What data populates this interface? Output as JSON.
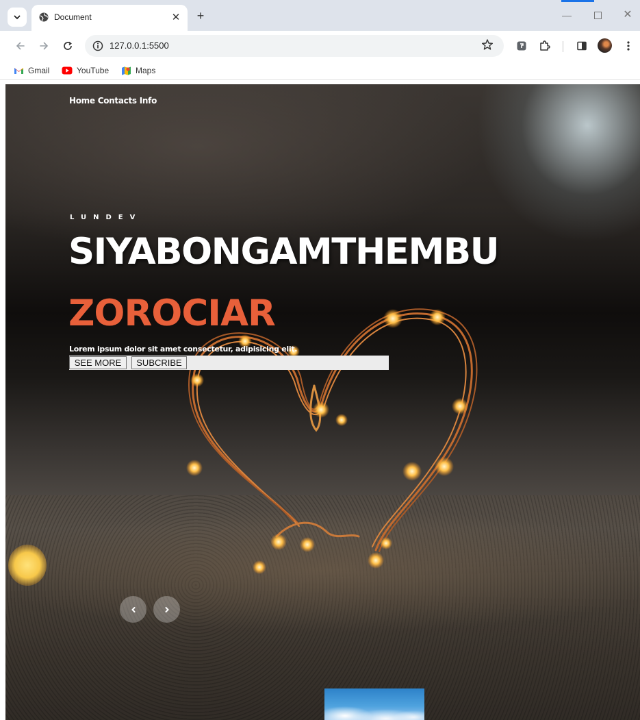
{
  "browser": {
    "tab_title": "Document",
    "url": "127.0.0.1:5500",
    "bookmarks": [
      {
        "label": "Gmail"
      },
      {
        "label": "YouTube"
      },
      {
        "label": "Maps"
      }
    ]
  },
  "page": {
    "nav": [
      "Home",
      "Contacts",
      "Info"
    ],
    "brand": "LUNDEV",
    "headline": "SIYABONGAMTHEMBU",
    "subhead": "ZOROCIAR",
    "description": "Lorem ipsum dolor sit amet consectetur, adipisicing elit.",
    "buttons": {
      "see_more": "SEE MORE",
      "subscribe": "SUBCRIBE"
    },
    "accent_color": "#e8603a"
  }
}
